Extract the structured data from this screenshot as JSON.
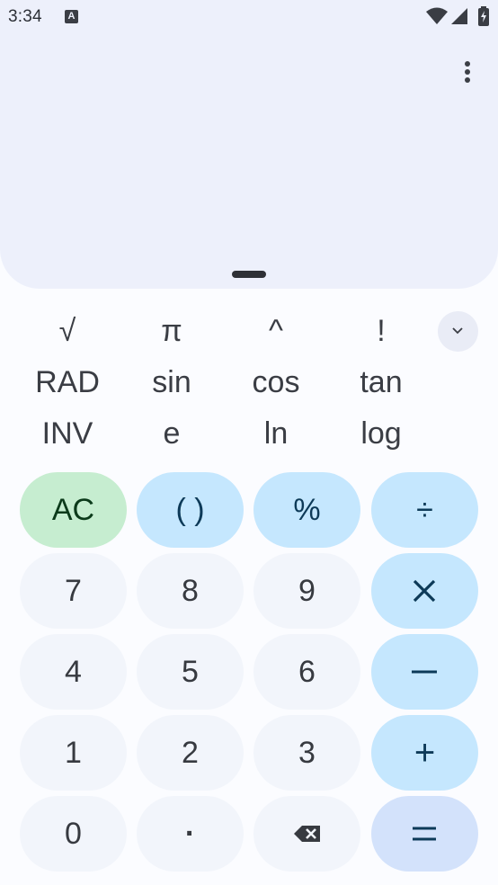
{
  "status_bar": {
    "time": "3:34",
    "notification_glyph": "A",
    "icons": [
      "wifi-icon",
      "signal-icon",
      "battery-charging-icon"
    ]
  },
  "display": {
    "menu_icon": "more-vert-icon",
    "handle_icon": "drag-handle-icon"
  },
  "scientific": {
    "rows": [
      [
        "√",
        "π",
        "^",
        "!"
      ],
      [
        "RAD",
        "sin",
        "cos",
        "tan"
      ],
      [
        "INV",
        "e",
        "ln",
        "log"
      ]
    ],
    "collapse_icon": "chevron-down-icon"
  },
  "keypad": {
    "ac": "AC",
    "parens": "( )",
    "percent": "%",
    "divide": "÷",
    "seven": "7",
    "eight": "8",
    "nine": "9",
    "four": "4",
    "five": "5",
    "six": "6",
    "one": "1",
    "two": "2",
    "three": "3",
    "plus": "+",
    "zero": "0",
    "decimal": "·",
    "multiply_icon": "times-icon",
    "minus_icon": "minus-icon",
    "backspace_icon": "backspace-icon",
    "equals_icon": "equals-icon"
  },
  "colors": {
    "display_bg": "#edf0fb",
    "number_key": "#f2f5fb",
    "operator_key": "#c5e7fe",
    "clear_key": "#c6edd0",
    "equals_key": "#d3e2fb"
  }
}
